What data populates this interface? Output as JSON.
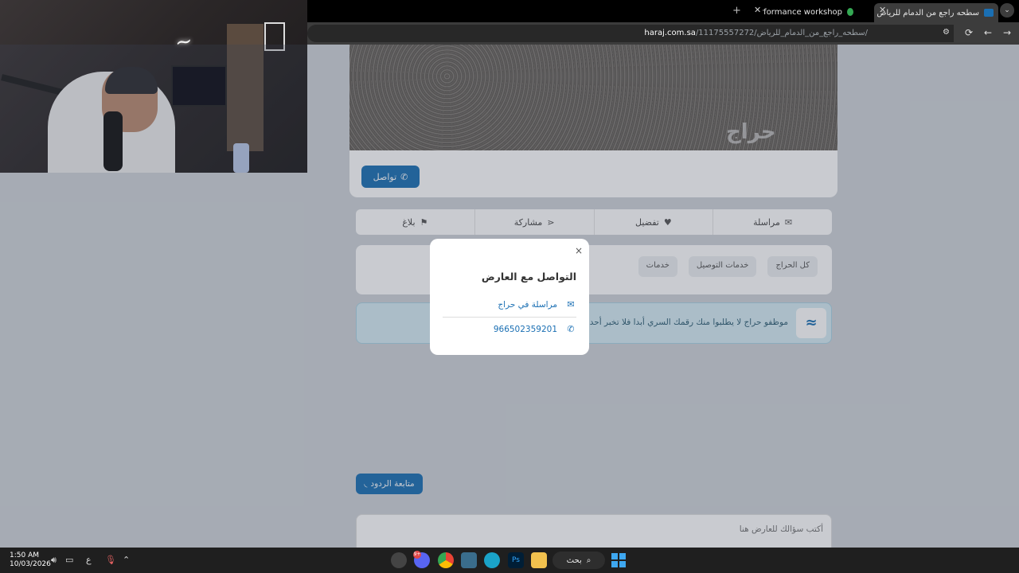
{
  "browser": {
    "tabs": [
      {
        "title": "سطحه راجع من الدمام للرياض | حراج",
        "active": true
      },
      {
        "title": "Speedtech performance workshop",
        "active": false
      }
    ],
    "url_domain": "haraj.com.sa",
    "url_path": "/11175557272/سطحه_راجع_من_الدمام_للرياض/"
  },
  "listing": {
    "contact_button": "تواصل",
    "watermark": "حراج",
    "actions": [
      {
        "label": "مراسلة",
        "icon": "envelope-icon"
      },
      {
        "label": "تفضيل",
        "icon": "heart-icon"
      },
      {
        "label": "مشاركة",
        "icon": "share-icon"
      },
      {
        "label": "بلاغ",
        "icon": "flag-icon"
      }
    ],
    "categories": [
      "كل الحراج",
      "خدمات التوصيل",
      "خدمات"
    ],
    "notice": "موظفو حراج لا يطلبوا منك رقمك السري أبدا فلا تخبر أحد به",
    "follow_button": "متابعة الردود",
    "question_placeholder": "أكتب سؤالك للعارض هنا"
  },
  "modal": {
    "title": "التواصل مع العارض",
    "close": "×",
    "message_option": "مراسلة في حراج",
    "phone": "966502359201"
  },
  "taskbar": {
    "time": "1:50 AM",
    "date": "10/03/2026",
    "lang": "ع",
    "search": "بحث",
    "notification_count": "9+"
  },
  "colors": {
    "primary": "#1a6fb3",
    "notice_bg": "#d6ecf4"
  }
}
